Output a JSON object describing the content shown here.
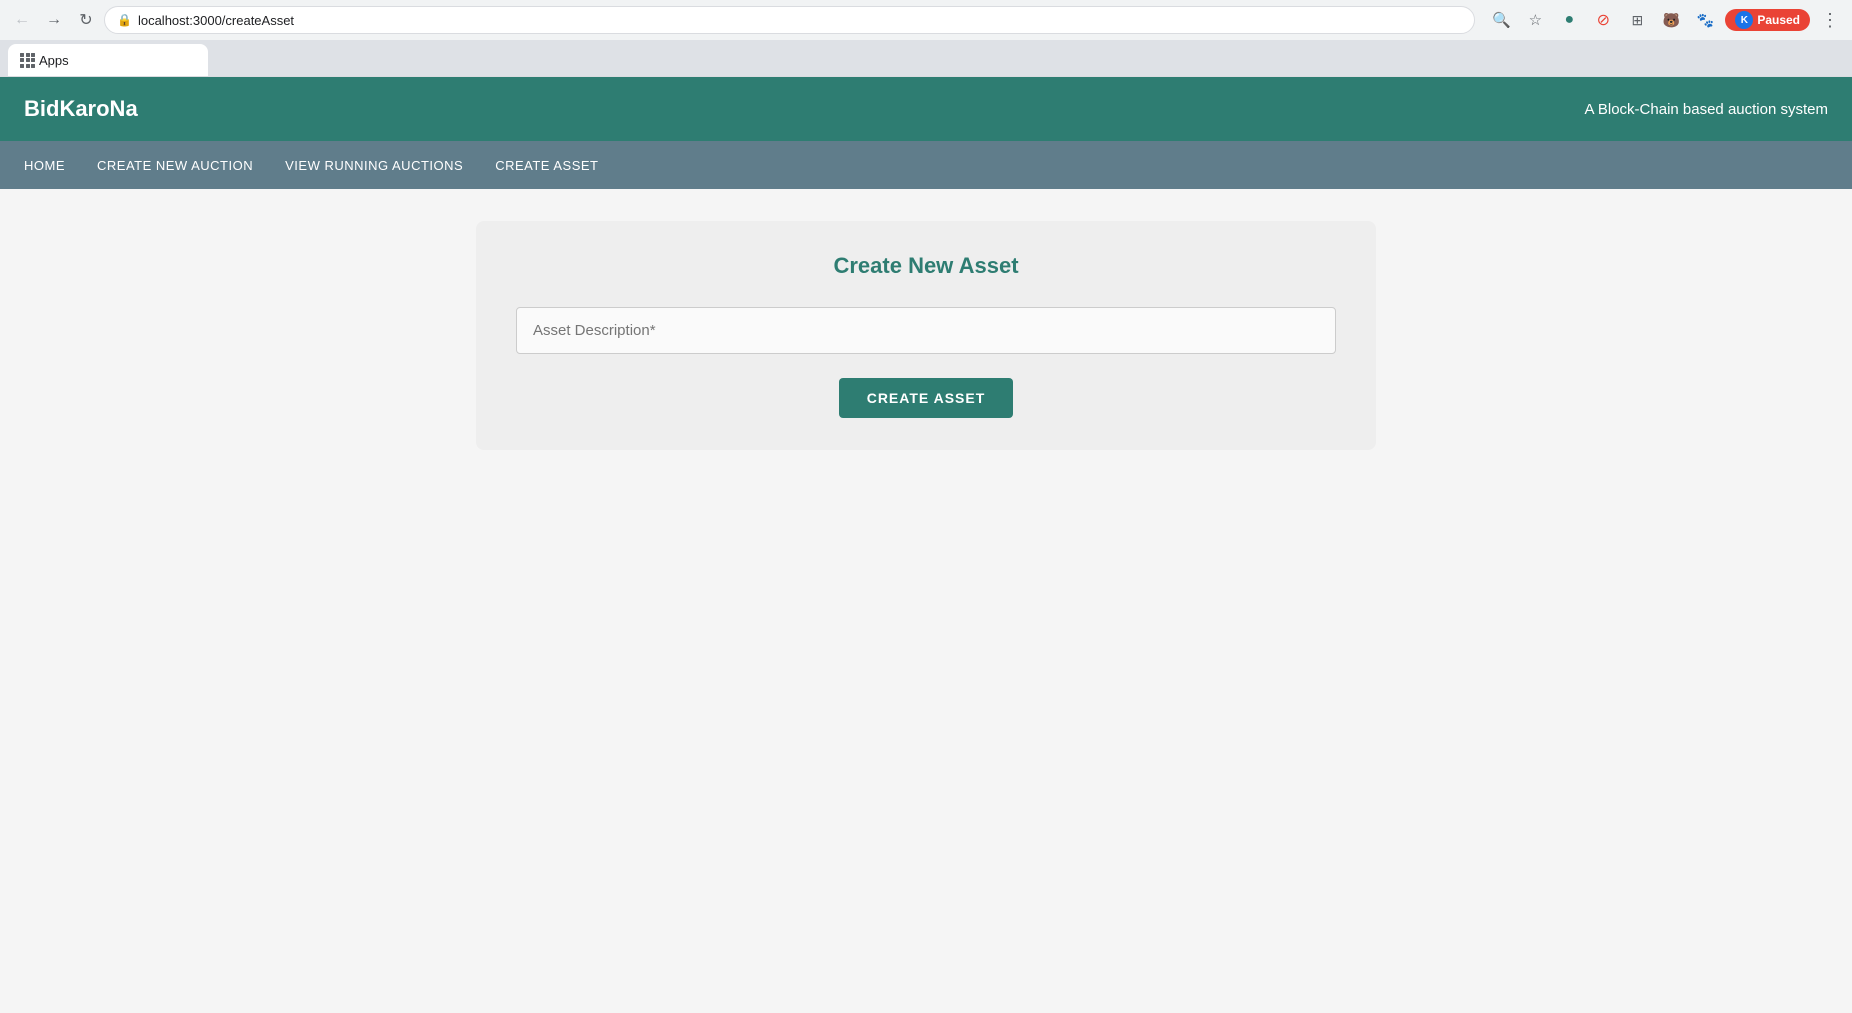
{
  "browser": {
    "url": "localhost:3000/createAsset",
    "tab_title": "Apps",
    "paused_label": "Paused",
    "avatar_letter": "K"
  },
  "header": {
    "logo": "BidKaroNa",
    "tagline": "A Block-Chain based auction system"
  },
  "nav": {
    "items": [
      {
        "label": "HOME",
        "href": "/"
      },
      {
        "label": "CREATE NEW AUCTION",
        "href": "/createAuction"
      },
      {
        "label": "VIEW RUNNING AUCTIONS",
        "href": "/auctions"
      },
      {
        "label": "CREATE ASSET",
        "href": "/createAsset"
      }
    ]
  },
  "form": {
    "title": "Create New Asset",
    "input_placeholder": "Asset Description*",
    "submit_label": "CREATE ASSET"
  }
}
